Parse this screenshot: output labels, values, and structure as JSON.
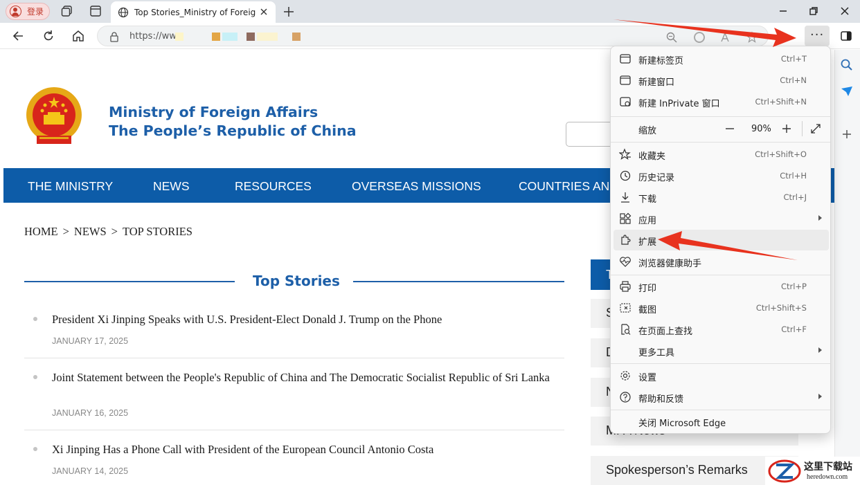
{
  "browser": {
    "profile_label": "登录",
    "tab_title": "Top Stories_Ministry of Foreign Af",
    "url_prefix": "https://ww"
  },
  "site": {
    "title_line1": "Ministry of Foreign Affairs",
    "title_line2": "The People’s Republic of China",
    "nav": [
      "THE MINISTRY",
      "NEWS",
      "RESOURCES",
      "OVERSEAS MISSIONS",
      "COUNTRIES AND"
    ],
    "breadcrumb": {
      "home": "HOME",
      "news": "NEWS",
      "current": "TOP STORIES",
      "sep": ">"
    },
    "section_heading": "Top Stories",
    "stories": [
      {
        "title": "President Xi Jinping Speaks with U.S. President-Elect  Donald J. Trump on the Phone",
        "date": "JANUARY 17, 2025"
      },
      {
        "title": "Joint Statement between the People's Republic of China and  The Democratic Socialist Republic of Sri Lanka",
        "date": "JANUARY 16, 2025"
      },
      {
        "title": "Xi Jinping Has a Phone Call with President of the European Council Antonio Costa",
        "date": "JANUARY 14, 2025"
      }
    ],
    "sidebar_partial": [
      "T",
      "S",
      "D",
      "N",
      "MFA News",
      "Spokesperson’s Remarks"
    ]
  },
  "menu": {
    "items": [
      {
        "label": "新建标签页",
        "shortcut": "Ctrl+T"
      },
      {
        "label": "新建窗口",
        "shortcut": "Ctrl+N"
      },
      {
        "label": "新建 InPrivate 窗口",
        "shortcut": "Ctrl+Shift+N"
      },
      {
        "label": "缩放",
        "zoom": "90%"
      },
      {
        "label": "收藏夹",
        "shortcut": "Ctrl+Shift+O"
      },
      {
        "label": "历史记录",
        "shortcut": "Ctrl+H"
      },
      {
        "label": "下载",
        "shortcut": "Ctrl+J"
      },
      {
        "label": "应用",
        "shortcut": ""
      },
      {
        "label": "扩展",
        "shortcut": ""
      },
      {
        "label": "浏览器健康助手",
        "shortcut": ""
      },
      {
        "label": "打印",
        "shortcut": "Ctrl+P"
      },
      {
        "label": "截图",
        "shortcut": "Ctrl+Shift+S"
      },
      {
        "label": "在页面上查找",
        "shortcut": "Ctrl+F"
      },
      {
        "label": "更多工具",
        "shortcut": ""
      },
      {
        "label": "设置",
        "shortcut": ""
      },
      {
        "label": "帮助和反馈",
        "shortcut": ""
      },
      {
        "label": "关闭 Microsoft Edge",
        "shortcut": ""
      }
    ]
  },
  "watermark": {
    "cn": "这里下载站",
    "en": "heredown.com"
  },
  "colors": {
    "brand_blue": "#0d5ca8",
    "title_blue": "#1d5fa8",
    "arrow_red": "#e8321e"
  }
}
